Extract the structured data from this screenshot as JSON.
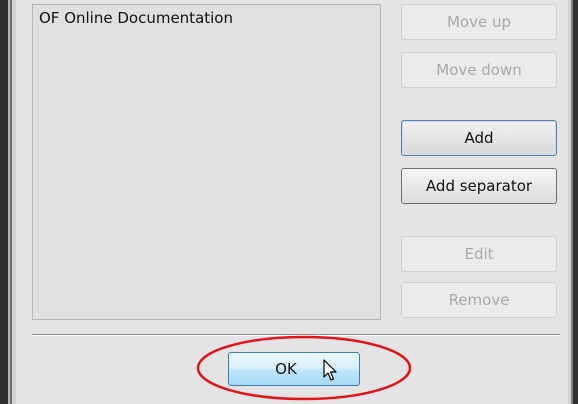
{
  "list": {
    "items": [
      {
        "label": "OF Online Documentation"
      }
    ]
  },
  "buttons": {
    "move_up": "Move up",
    "move_down": "Move down",
    "add": "Add",
    "add_separator": "Add separator",
    "edit": "Edit",
    "remove": "Remove",
    "ok": "OK"
  },
  "states": {
    "move_up_enabled": false,
    "move_down_enabled": false,
    "add_enabled": true,
    "add_separator_enabled": true,
    "edit_enabled": false,
    "remove_enabled": false
  },
  "annotation": {
    "highlight_color": "#e0141a",
    "cursor_icon": "mouse-pointer-icon"
  }
}
